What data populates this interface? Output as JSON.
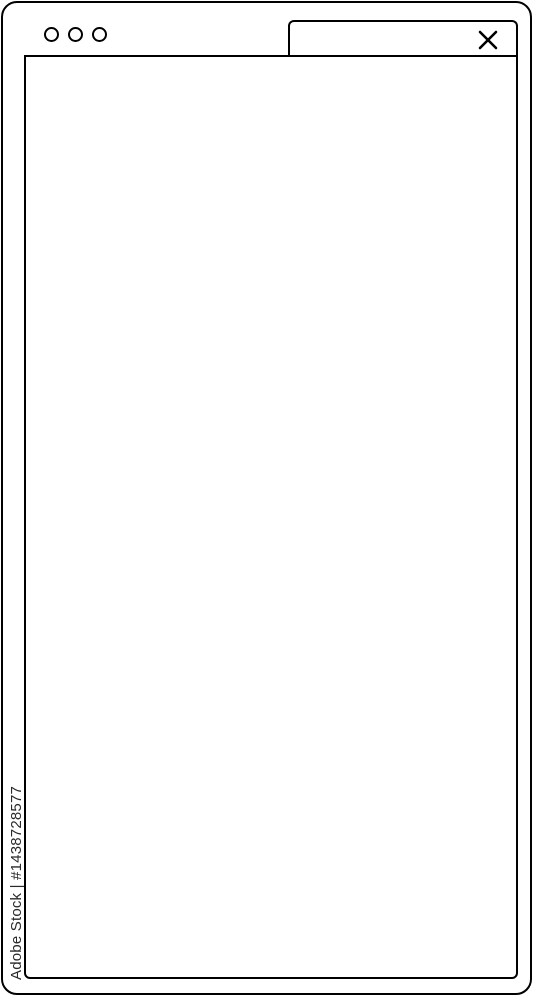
{
  "window": {
    "controls": [
      "circle",
      "circle",
      "circle"
    ],
    "close_icon": "close-icon"
  },
  "watermark": {
    "text": "Adobe Stock | #1438728577"
  }
}
